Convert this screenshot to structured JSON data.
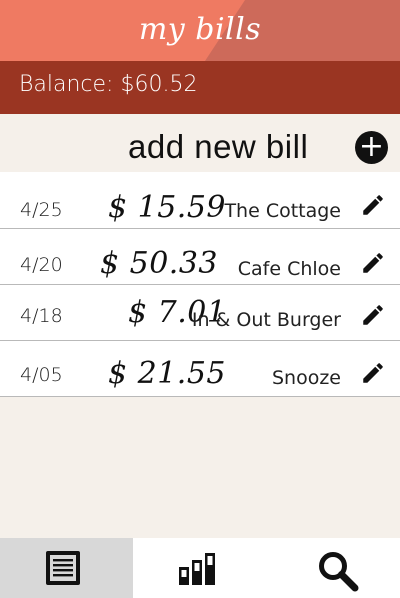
{
  "app": {
    "title": "my bills"
  },
  "balance": {
    "text": "Balance: $60.52"
  },
  "add_bill": {
    "label": "add new bill",
    "button_glyph": "+"
  },
  "bills": [
    {
      "date": "4/25",
      "amount": "$ 15.59",
      "name": "The Cottage",
      "icon": "pencil-icon"
    },
    {
      "date": "4/20",
      "amount": "$ 50.33",
      "name": "Cafe Chloe",
      "icon": "pencil-icon"
    },
    {
      "date": "4/18",
      "amount": "$ 7.01",
      "name": "In & Out Burger",
      "icon": "pencil-icon"
    },
    {
      "date": "4/05",
      "amount": "$ 21.55",
      "name": "Snooze",
      "icon": "pencil-icon"
    }
  ],
  "tabs": [
    {
      "icon": "list-icon",
      "active": true
    },
    {
      "icon": "bar-chart-icon",
      "active": false
    },
    {
      "icon": "search-icon",
      "active": false
    }
  ],
  "colors": {
    "header": "#ef7a62",
    "header_wedge": "#cd6a5a",
    "balance_bar": "#9a3522",
    "background": "#f5f0ea"
  }
}
